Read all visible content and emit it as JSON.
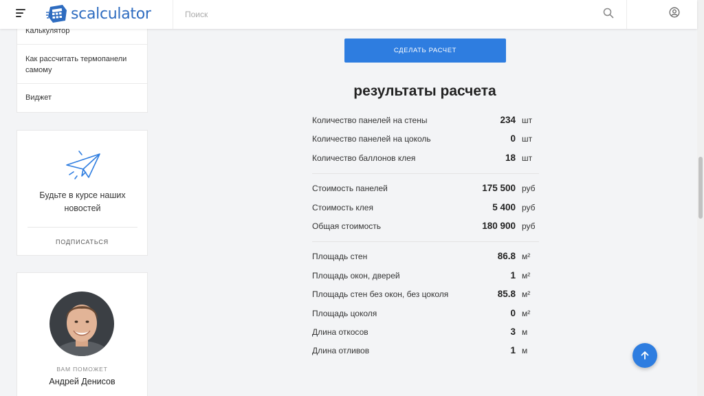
{
  "header": {
    "logo_text": "scalculator",
    "search_placeholder": "Поиск"
  },
  "sidebar": {
    "nav_items": [
      {
        "label": "Калькулятор"
      },
      {
        "label": "Как рассчитать термопанели самому"
      },
      {
        "label": "Виджет"
      }
    ],
    "subscribe": {
      "text": "Будьте в курсе наших новостей",
      "link": "ПОДПИСАТЬСЯ"
    },
    "helper": {
      "label": "ВАМ ПОМОЖЕТ",
      "name": "Андрей Денисов"
    }
  },
  "main": {
    "calc_button": "СДЕЛАТЬ РАСЧЕТ",
    "results_title": "результаты расчета",
    "groups": [
      {
        "rows": [
          {
            "label": "Количество панелей на стены",
            "value": "234",
            "unit": "шт"
          },
          {
            "label": "Количество панелей на цоколь",
            "value": "0",
            "unit": "шт"
          },
          {
            "label": "Количество баллонов клея",
            "value": "18",
            "unit": "шт"
          }
        ]
      },
      {
        "rows": [
          {
            "label": "Стоимость панелей",
            "value": "175 500",
            "unit": "руб"
          },
          {
            "label": "Стоимость клея",
            "value": "5 400",
            "unit": "руб"
          },
          {
            "label": "Общая стоимость",
            "value": "180 900",
            "unit": "руб"
          }
        ]
      },
      {
        "rows": [
          {
            "label": "Площадь стен",
            "value": "86.8",
            "unit": "м²"
          },
          {
            "label": "Площадь окон, дверей",
            "value": "1",
            "unit": "м²"
          },
          {
            "label": "Площадь стен без окон, без цоколя",
            "value": "85.8",
            "unit": "м²"
          },
          {
            "label": "Площадь цоколя",
            "value": "0",
            "unit": "м²"
          },
          {
            "label": "Длина откосов",
            "value": "3",
            "unit": "м"
          },
          {
            "label": "Длина отливов",
            "value": "1",
            "unit": "м"
          }
        ]
      }
    ]
  },
  "colors": {
    "accent": "#2e7de0",
    "logo": "#2e6cc0"
  },
  "icons": [
    "menu-icon",
    "logo-icon",
    "search-icon",
    "user-icon",
    "paper-plane-icon",
    "arrow-up-icon"
  ]
}
